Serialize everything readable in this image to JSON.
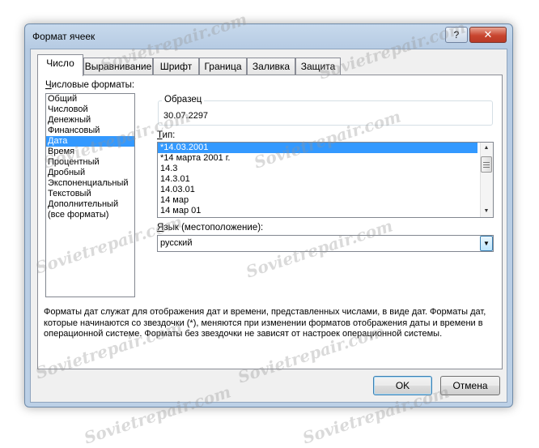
{
  "window": {
    "title": "Формат ячеек",
    "help_label": "?",
    "close_label": "✕"
  },
  "tabs": [
    {
      "label": "Число",
      "active": true
    },
    {
      "label": "Выравнивание",
      "active": false
    },
    {
      "label": "Шрифт",
      "active": false
    },
    {
      "label": "Граница",
      "active": false
    },
    {
      "label": "Заливка",
      "active": false
    },
    {
      "label": "Защита",
      "active": false
    }
  ],
  "category": {
    "label": "Числовые форматы:",
    "items": [
      "Общий",
      "Числовой",
      "Денежный",
      "Финансовый",
      "Дата",
      "Время",
      "Процентный",
      "Дробный",
      "Экспоненциальный",
      "Текстовый",
      "Дополнительный",
      "(все форматы)"
    ],
    "selected_index": 4
  },
  "sample": {
    "label": "Образец",
    "value": "30.07.2297"
  },
  "type": {
    "label": "Тип:",
    "items": [
      "*14.03.2001",
      "*14 марта 2001 г.",
      "14.3",
      "14.3.01",
      "14.03.01",
      "14 мар",
      "14 мар 01"
    ],
    "selected_index": 0,
    "scroll_up_icon": "▲",
    "scroll_down_icon": "▼"
  },
  "locale": {
    "label": "Язык (местоположение):",
    "value": "русский",
    "dropdown_icon": "▼"
  },
  "description": "Форматы дат служат для отображения дат и времени, представленных числами, в виде дат. Форматы дат, которые начинаются со звездочки (*), меняются при изменении форматов отображения даты и времени в операционной системе. Форматы без звездочки не зависят от настроек операционной системы.",
  "buttons": {
    "ok": "OK",
    "cancel": "Отмена"
  },
  "watermark": "Sovietrepair.com",
  "colors": {
    "selection": "#3399ff",
    "window_frame": "#b6cbe3",
    "close_button": "#c8452f"
  }
}
